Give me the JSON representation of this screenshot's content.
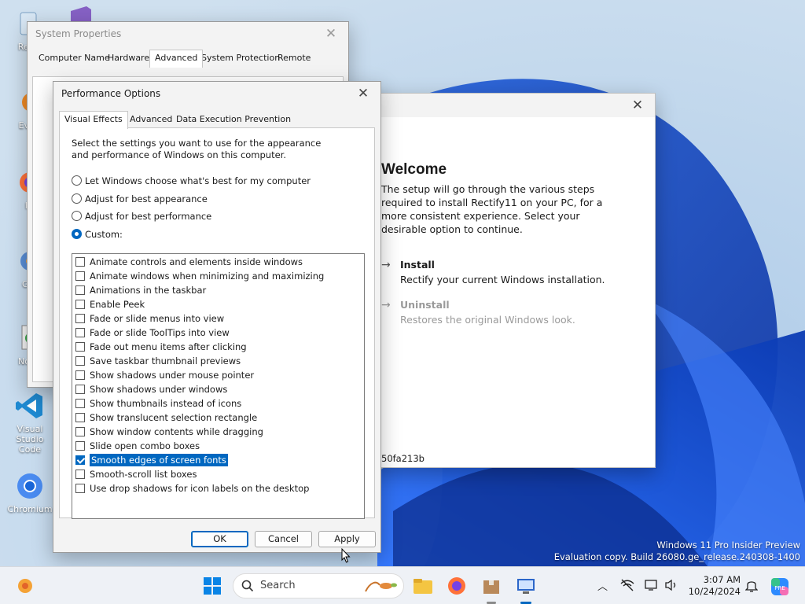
{
  "desktop": {
    "icons": [
      {
        "label": "Recy",
        "icon": "recycle-bin-icon"
      },
      {
        "label": "Ever",
        "icon": "everything-icon"
      },
      {
        "label": "Fi",
        "icon": "firefox-icon"
      },
      {
        "label": "Git",
        "icon": "git-icon"
      },
      {
        "label": "Note",
        "icon": "notepad-icon"
      },
      {
        "label": "Visual Studio Code",
        "icon": "vscode-icon"
      },
      {
        "label": "Chromium",
        "icon": "chromium-icon"
      }
    ]
  },
  "system_properties": {
    "title": "System Properties",
    "tabs": [
      "Computer Name",
      "Hardware",
      "Advanced",
      "System Protection",
      "Remote"
    ],
    "active_tab": "Advanced"
  },
  "setup": {
    "heading": "Welcome",
    "description": "The setup will go through the various steps required to install Rectify11 on your PC, for a more consistent experience. Select your desirable option to continue.",
    "install_title": "Install",
    "install_desc": "Rectify your current Windows installation.",
    "uninstall_title": "Uninstall",
    "uninstall_desc": "Restores the original Windows look.",
    "hash": "50fa213b"
  },
  "performance_options": {
    "title": "Performance Options",
    "tabs": [
      "Visual Effects",
      "Advanced",
      "Data Execution Prevention"
    ],
    "active_tab": "Visual Effects",
    "intro": "Select the settings you want to use for the appearance and performance of Windows on this computer.",
    "radios": [
      {
        "label": "Let Windows choose what's best for my computer",
        "checked": false
      },
      {
        "label": "Adjust for best appearance",
        "checked": false
      },
      {
        "label": "Adjust for best performance",
        "checked": false
      },
      {
        "label": "Custom:",
        "checked": true
      }
    ],
    "options": [
      {
        "label": "Animate controls and elements inside windows",
        "checked": false
      },
      {
        "label": "Animate windows when minimizing and maximizing",
        "checked": false
      },
      {
        "label": "Animations in the taskbar",
        "checked": false
      },
      {
        "label": "Enable Peek",
        "checked": false
      },
      {
        "label": "Fade or slide menus into view",
        "checked": false
      },
      {
        "label": "Fade or slide ToolTips into view",
        "checked": false
      },
      {
        "label": "Fade out menu items after clicking",
        "checked": false
      },
      {
        "label": "Save taskbar thumbnail previews",
        "checked": false
      },
      {
        "label": "Show shadows under mouse pointer",
        "checked": false
      },
      {
        "label": "Show shadows under windows",
        "checked": false
      },
      {
        "label": "Show thumbnails instead of icons",
        "checked": false
      },
      {
        "label": "Show translucent selection rectangle",
        "checked": false
      },
      {
        "label": "Show window contents while dragging",
        "checked": false
      },
      {
        "label": "Slide open combo boxes",
        "checked": false
      },
      {
        "label": "Smooth edges of screen fonts",
        "checked": true,
        "selected": true
      },
      {
        "label": "Smooth-scroll list boxes",
        "checked": false
      },
      {
        "label": "Use drop shadows for icon labels on the desktop",
        "checked": false
      }
    ],
    "buttons": {
      "ok": "OK",
      "cancel": "Cancel",
      "apply": "Apply"
    }
  },
  "watermark": {
    "line1": "Windows 11 Pro Insider Preview",
    "line2": "Evaluation copy. Build 26080.ge_release.240308-1400"
  },
  "taskbar": {
    "search_placeholder": "Search",
    "time": "3:07 AM",
    "date": "10/24/2024",
    "accent": "#0067c0"
  }
}
